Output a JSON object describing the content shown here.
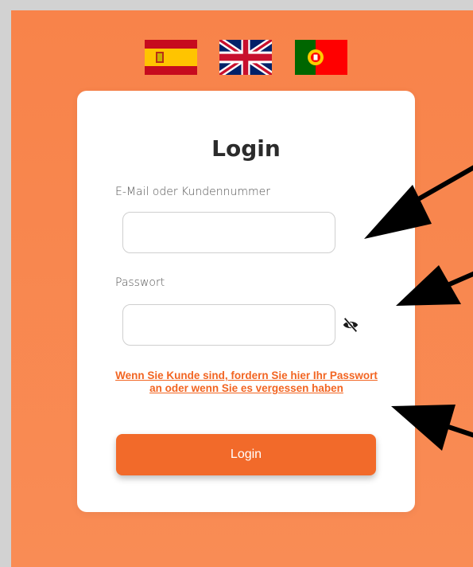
{
  "languages": [
    {
      "name": "Español",
      "icon": "spain-flag-icon"
    },
    {
      "name": "English",
      "icon": "uk-flag-icon"
    },
    {
      "name": "Português",
      "icon": "portugal-flag-icon"
    }
  ],
  "login": {
    "title": "Login",
    "email_label": "E-Mail oder Kundennummer",
    "email_value": "",
    "password_label": "Passwort",
    "password_value": "",
    "toggle_icon": "eye-slash-icon",
    "forgot_link": "Wenn Sie Kunde sind, fordern Sie hier Ihr Passwort an oder wenn Sie es vergessen haben",
    "submit_label": "Login"
  },
  "colors": {
    "background": "#f8834a",
    "accent": "#f26a2a",
    "link": "#f26522"
  }
}
